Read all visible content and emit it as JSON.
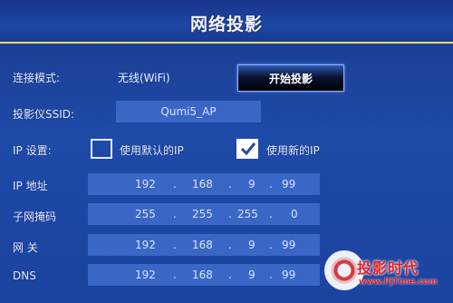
{
  "header": {
    "title": "网络投影"
  },
  "connection": {
    "label": "连接模式:",
    "value": "无线(WiFi)",
    "start_button": "开始投影"
  },
  "ssid": {
    "label": "投影仪SSID:",
    "value": "Qumi5_AP"
  },
  "ip_setting": {
    "label": "IP 设置:",
    "default_option": {
      "label": "使用默认的IP",
      "checked": false
    },
    "new_option": {
      "label": "使用新的IP",
      "checked": true
    }
  },
  "fields": {
    "ip": {
      "label": "IP 地址",
      "octets": [
        "192",
        ".",
        "168",
        ".",
        "9",
        ".",
        "99"
      ]
    },
    "mask": {
      "label": "子网掩码",
      "octets": [
        "255",
        ".",
        "255",
        ".",
        "255",
        ".",
        "0"
      ]
    },
    "gateway": {
      "label": "网   关",
      "octets": [
        "192",
        ".",
        "168",
        ".",
        "9",
        ".",
        "99"
      ]
    },
    "dns": {
      "label": "DNS",
      "octets": [
        "192",
        ".",
        "168",
        ".",
        "9",
        ".",
        "99"
      ]
    }
  },
  "watermark": {
    "name": "投影时代",
    "url": "www.PjTime.com"
  },
  "colors": {
    "title_underline": "#e8e06a",
    "field_bg": "#3a66c6",
    "logo_red": "#e0202a"
  }
}
